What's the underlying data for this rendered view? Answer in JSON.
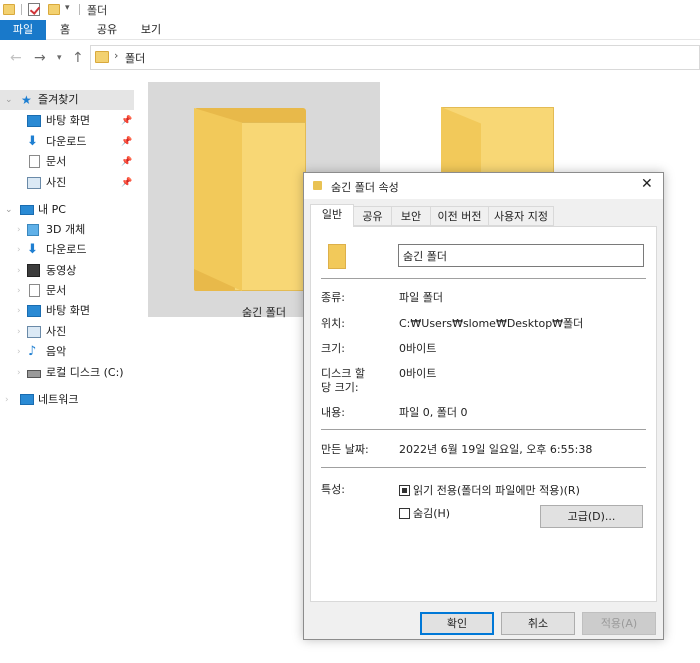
{
  "window": {
    "title": "폴더"
  },
  "ribbon": {
    "tabs": [
      "파일",
      "홈",
      "공유",
      "보기"
    ]
  },
  "address": {
    "path": "폴더"
  },
  "sidebar": {
    "quick_access": "즐겨찾기",
    "quick_items": [
      "바탕 화면",
      "다운로드",
      "문서",
      "사진"
    ],
    "this_pc": "내 PC",
    "pc_items": [
      "3D 개체",
      "다운로드",
      "동영상",
      "문서",
      "바탕 화면",
      "사진",
      "음악",
      "로컬 디스크 (C:)"
    ],
    "network": "네트워크"
  },
  "content": {
    "items": [
      {
        "label": "숨긴 폴더"
      }
    ]
  },
  "dialog": {
    "title": "숨긴 폴더 속성",
    "tabs": [
      "일반",
      "공유",
      "보안",
      "이전 버전",
      "사용자 지정"
    ],
    "name_value": "숨긴 폴더",
    "props": {
      "type_label": "종류:",
      "type_value": "파일 폴더",
      "location_label": "위치:",
      "location_value": "C:₩Users₩slome₩Desktop₩폴더",
      "size_label": "크기:",
      "size_value": "0바이트",
      "disk_label_1": "디스크 할",
      "disk_label_2": "당 크기:",
      "disk_value": "0바이트",
      "contents_label": "내용:",
      "contents_value": "파일 0, 폴더 0",
      "created_label": "만든 날짜:",
      "created_value": "2022년 6월 19일 일요일, 오후 6:55:38",
      "attributes_label": "특성:",
      "readonly_label": "읽기 전용(폴더의 파일에만 적용)(R)",
      "hidden_label": "숨김(H)",
      "advanced_label": "고급(D)..."
    },
    "buttons": {
      "ok": "확인",
      "cancel": "취소",
      "apply": "적용(A)"
    }
  },
  "colors": {
    "accent": "#1979ca",
    "folder": "#f8d775",
    "selection": "#d9d9d9"
  }
}
